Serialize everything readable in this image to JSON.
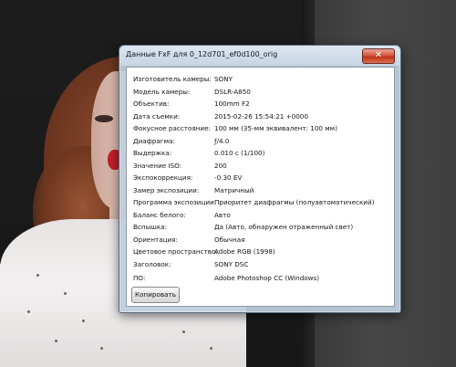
{
  "dialog": {
    "title": "Данные FxF для 0_12d701_ef0d100_orig",
    "close_glyph": "✕",
    "copy_label": "Копировать"
  },
  "exif": [
    {
      "label": "Изготовитель камеры:",
      "value": "SONY"
    },
    {
      "label": "Модель камеры:",
      "value": "DSLR-A850"
    },
    {
      "label": "Объектив:",
      "value": "100mm F2"
    },
    {
      "label": "Дата съемки:",
      "value": "2015-02-26 15:54:21 +0000"
    },
    {
      "label": "Фокусное расстояние:",
      "value": "100 мм (35-мм эквивалент: 100 мм)"
    },
    {
      "label": "Диафрагма:",
      "value": "ƒ/4.0"
    },
    {
      "label": "Выдержка:",
      "value": "0.010 с (1/100)"
    },
    {
      "label": "Значение ISO:",
      "value": "200"
    },
    {
      "label": "Экспокоррекция:",
      "value": "-0.30 EV"
    },
    {
      "label": "Замер экспозиции:",
      "value": "Матричный"
    },
    {
      "label": "Программа экспозиции:",
      "value": "Приоритет диафрагмы (полуавтоматический)"
    },
    {
      "label": "Баланс белого:",
      "value": "Авто"
    },
    {
      "label": "Вспышка:",
      "value": "Да (Авто, обнаружен отраженный свет)"
    },
    {
      "label": "Ориентация:",
      "value": "Обычная"
    },
    {
      "label": "Цветовое пространство:",
      "value": "Adobe RGB (1998)"
    },
    {
      "label": "Заголовок:",
      "value": "SONY DSC"
    },
    {
      "label": "ПО:",
      "value": "Adobe Photoshop CC (Windows)"
    }
  ]
}
